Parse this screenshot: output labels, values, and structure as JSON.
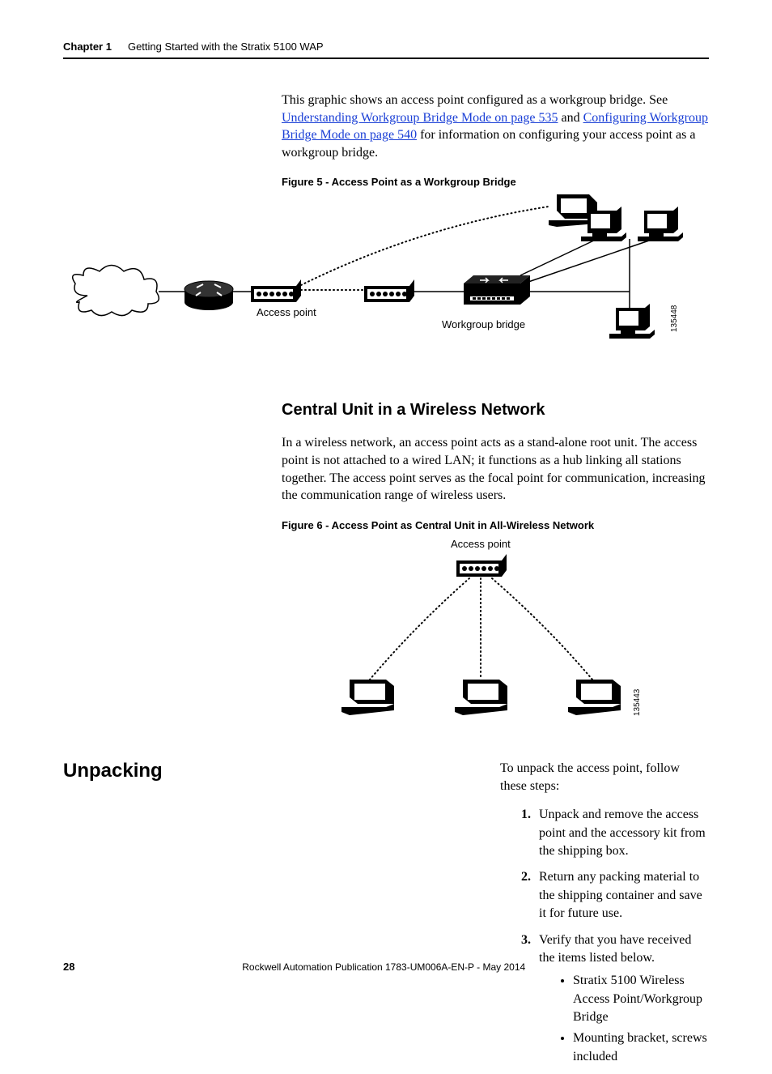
{
  "header": {
    "chapter": "Chapter 1",
    "title": "Getting Started with the Stratix 5100 WAP"
  },
  "intro_p1a": "This graphic shows an access point configured as a workgroup bridge. See ",
  "intro_link1": "Understanding Workgroup Bridge Mode on page 535",
  "intro_p1b": " and ",
  "intro_link2": "Configuring Workgroup Bridge Mode on page 540",
  "intro_p1c": " for information on configuring your access point as a workgroup bridge.",
  "fig5_caption": "Figure 5 - Access Point as a Workgroup Bridge",
  "fig5_labels": {
    "access_point": "Access point",
    "workgroup_bridge": "Workgroup bridge",
    "code": "135448"
  },
  "section2_heading": "Central Unit in a Wireless Network",
  "section2_p1": "In a wireless network, an access point acts as a stand-alone root unit. The access point is not attached to a wired LAN; it functions as a hub linking all stations together. The access point serves as the focal point for communication, increasing the communication range of wireless users.",
  "fig6_caption": "Figure 6 - Access Point as Central Unit in All-Wireless Network",
  "fig6_labels": {
    "access_point": "Access point",
    "code": "135443"
  },
  "unpacking_heading": "Unpacking",
  "unpacking_intro": "To unpack the access point, follow these steps:",
  "steps": [
    "Unpack and remove the access point and the accessory kit from the shipping box.",
    "Return any packing material to the shipping container and save it for future use.",
    "Verify that you have received the items listed below."
  ],
  "bullets": [
    "Stratix 5100 Wireless Access Point/Workgroup Bridge",
    "Mounting bracket, screws included"
  ],
  "footer": {
    "page": "28",
    "pub": "Rockwell Automation Publication 1783-UM006A-EN-P - May 2014"
  }
}
